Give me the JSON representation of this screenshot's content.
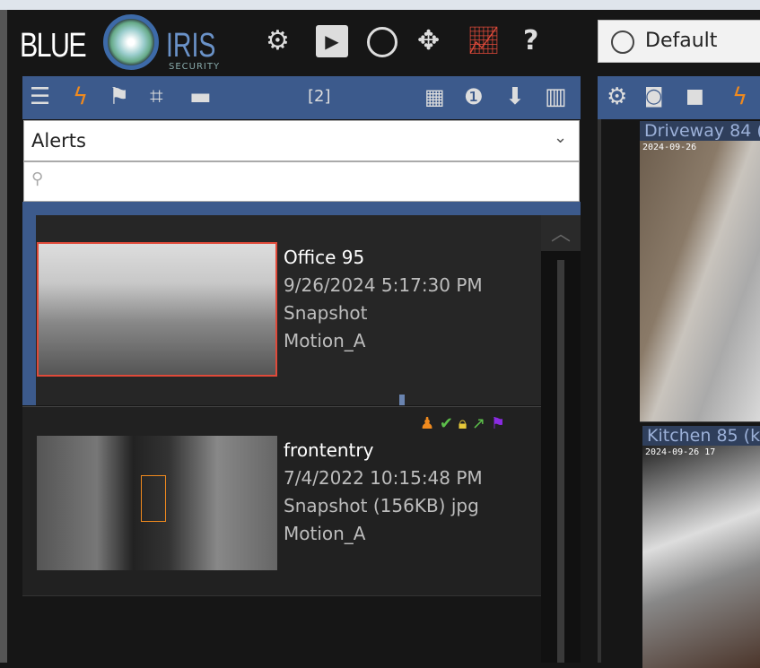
{
  "logo": {
    "word1": "BLUE",
    "word2": "IRIS",
    "sub": "SECURITY"
  },
  "toolbar": {
    "icons": [
      "gear-icon",
      "film-play-icon",
      "clock-icon",
      "move-icon",
      "chart-up-icon",
      "help-icon"
    ],
    "help": "?"
  },
  "profile": {
    "label": "Default"
  },
  "left_panel": {
    "count": "[2]",
    "filter": {
      "value": "Alerts"
    },
    "search": {
      "placeholder": ""
    },
    "alerts": [
      {
        "camera": "Office 95",
        "datetime": "9/26/2024 5:17:30 PM",
        "type": "Snapshot",
        "trigger": "Motion_A",
        "selected": true
      },
      {
        "camera": "frontentry",
        "datetime": "7/4/2022 10:15:48 PM",
        "type": "Snapshot (156KB) jpg",
        "trigger": "Motion_A",
        "flags": [
          "person-icon",
          "check-icon",
          "lock-icon",
          "external-link-icon",
          "flag-icon"
        ]
      }
    ]
  },
  "cameras": [
    {
      "title": "Driveway 84 (",
      "stamp": "2024-09-26"
    },
    {
      "title": "Kitchen 85 (k",
      "stamp": "2024-09-26 17"
    }
  ],
  "colors": {
    "header_blue": "#3c5a8c",
    "alert_red": "#e04a3a",
    "lightning": "#f08a1e",
    "flag_purple": "#8a2be2"
  }
}
